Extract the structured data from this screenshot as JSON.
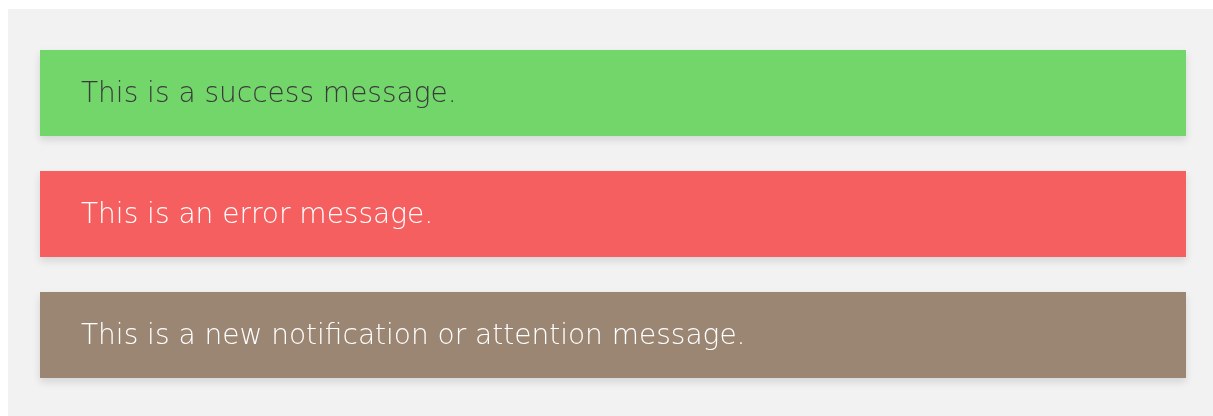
{
  "messages": [
    {
      "kind": "success",
      "color": "#72d66a",
      "text": "This is a success message."
    },
    {
      "kind": "error",
      "color": "#f65f5f",
      "text": "This is an error message."
    },
    {
      "kind": "notice",
      "color": "#9a8673",
      "text": "This is a new notification or attention message."
    }
  ]
}
